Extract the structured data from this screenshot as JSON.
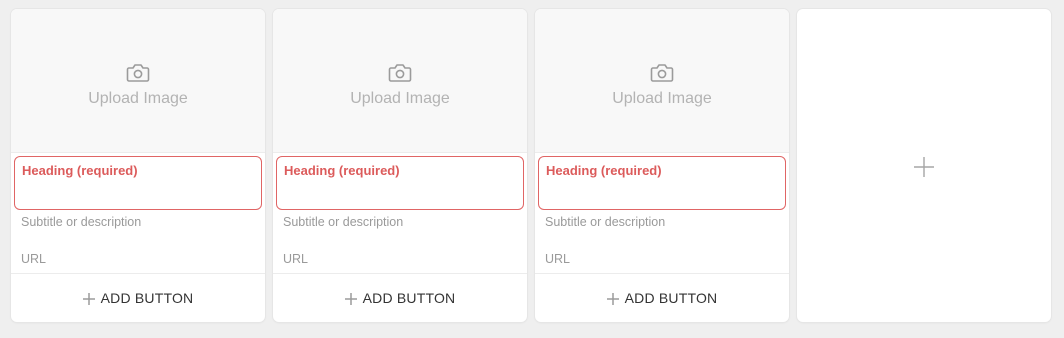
{
  "cards": [
    {
      "upload_label": "Upload Image",
      "heading_placeholder": "Heading (required)",
      "subtitle_placeholder": "Subtitle or description",
      "url_placeholder": "URL",
      "add_button_label": "ADD BUTTON"
    },
    {
      "upload_label": "Upload Image",
      "heading_placeholder": "Heading (required)",
      "subtitle_placeholder": "Subtitle or description",
      "url_placeholder": "URL",
      "add_button_label": "ADD BUTTON"
    },
    {
      "upload_label": "Upload Image",
      "heading_placeholder": "Heading (required)",
      "subtitle_placeholder": "Subtitle or description",
      "url_placeholder": "URL",
      "add_button_label": "ADD BUTTON"
    }
  ],
  "icons": {
    "upload": "camera-icon",
    "add_button": "plus-icon",
    "add_card": "plus-icon"
  },
  "colors": {
    "required_border": "#e06565",
    "required_text": "#dc5b5b",
    "placeholder_text": "#9a9a9a",
    "page_background": "#efefef"
  }
}
